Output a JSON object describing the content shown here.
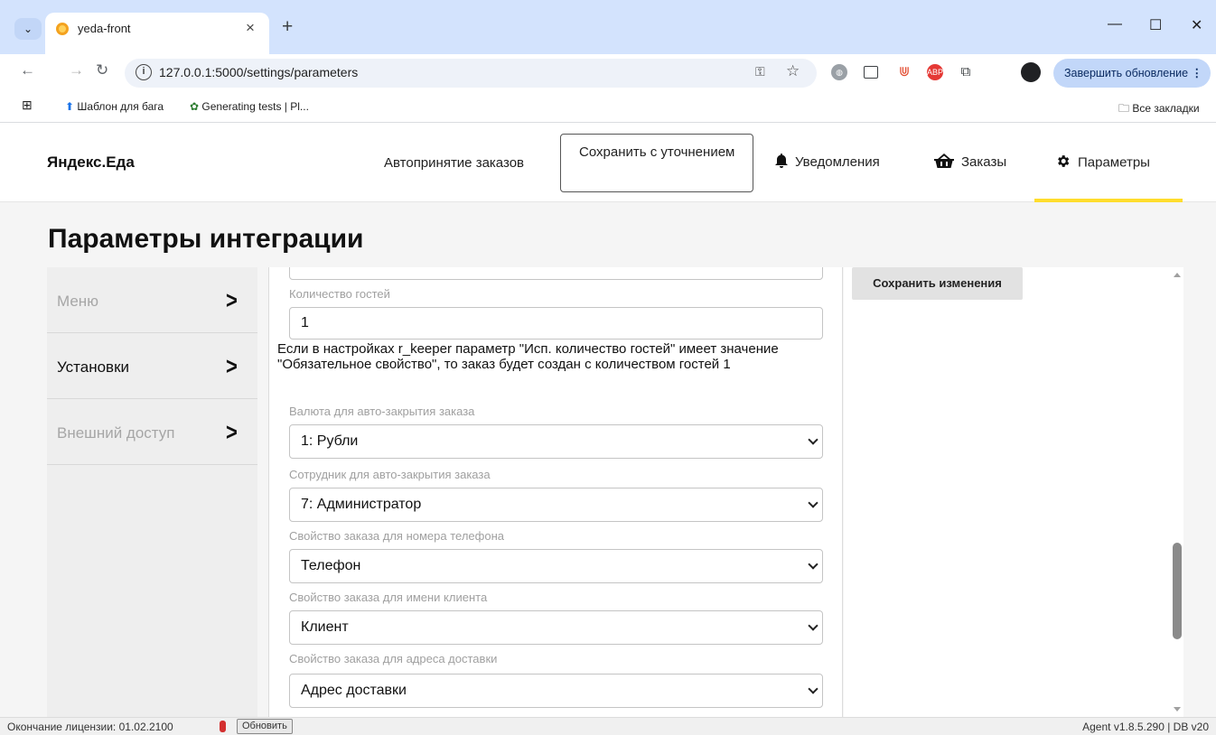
{
  "browser": {
    "tab_title": "yeda-front",
    "url": "127.0.0.1:5000/settings/parameters",
    "update_label": "Завершить обновление",
    "bookmarks": [
      "Шаблон для бага",
      "Generating tests | Pl..."
    ],
    "all_bookmarks": "Все закладки"
  },
  "app": {
    "logo": "Яндекс.Еда",
    "nav": {
      "autoaccept": "Автопринятие заказов",
      "save_clarify": "Сохранить с уточнением",
      "notifications": "Уведомления",
      "orders": "Заказы",
      "parameters": "Параметры"
    },
    "page_title": "Параметры интеграции",
    "sidebar": [
      {
        "label": "Меню",
        "active": false
      },
      {
        "label": "Установки",
        "active": true
      },
      {
        "label": "Внешний доступ",
        "active": false
      }
    ],
    "form": {
      "guests_label": "Количество гостей",
      "guests_value": "1",
      "guests_hint": "Если в настройках r_keeper параметр \"Исп. количество гостей\" имеет значение \"Обязательное свойство\", то заказ будет создан с количеством гостей 1",
      "currency_label": "Валюта для авто-закрытия заказа",
      "currency_value": "1: Рубли",
      "employee_label": "Сотрудник для авто-закрытия заказа",
      "employee_value": "7: Администратор",
      "phone_label": "Свойство заказа для номера телефона",
      "phone_value": "Телефон",
      "client_label": "Свойство заказа для имени клиента",
      "client_value": "Клиент",
      "address_label": "Свойство заказа для адреса доставки",
      "address_value": "Адрес доставки"
    },
    "save_changes": "Сохранить изменения"
  },
  "status": {
    "license": "Окончание лицензии: 01.02.2100",
    "refresh": "Обновить",
    "agent": "Agent v1.8.5.290  |  DB v20"
  },
  "colors": {
    "accent_yellow": "#ffdd2d",
    "license_indicator": "#d32f2f",
    "chrome_blue": "#d3e3fd"
  }
}
